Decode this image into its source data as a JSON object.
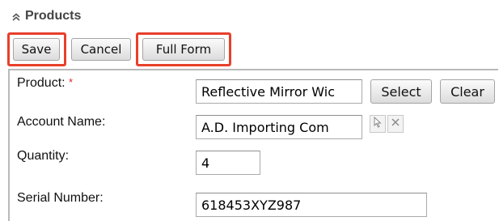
{
  "panel": {
    "title": "Products",
    "collapse_icon": "double-chevron-up-icon"
  },
  "toolbar": {
    "save_label": "Save",
    "cancel_label": "Cancel",
    "full_form_label": "Full Form",
    "highlight_color": "#e8402b"
  },
  "form": {
    "product": {
      "label": "Product:",
      "required_marker": "*",
      "value": "Reflective Mirror Wic",
      "select_label": "Select",
      "clear_label": "Clear"
    },
    "account_name": {
      "label": "Account Name:",
      "value": "A.D. Importing Com",
      "select_icon": "cursor-arrow-icon",
      "clear_icon": "close-icon"
    },
    "quantity": {
      "label": "Quantity:",
      "value": "4"
    },
    "serial_number": {
      "label": "Serial Number:",
      "value": "618453XYZ987"
    }
  },
  "colors": {
    "required": "#dd2222",
    "frame_border": "#b9b9b9"
  }
}
